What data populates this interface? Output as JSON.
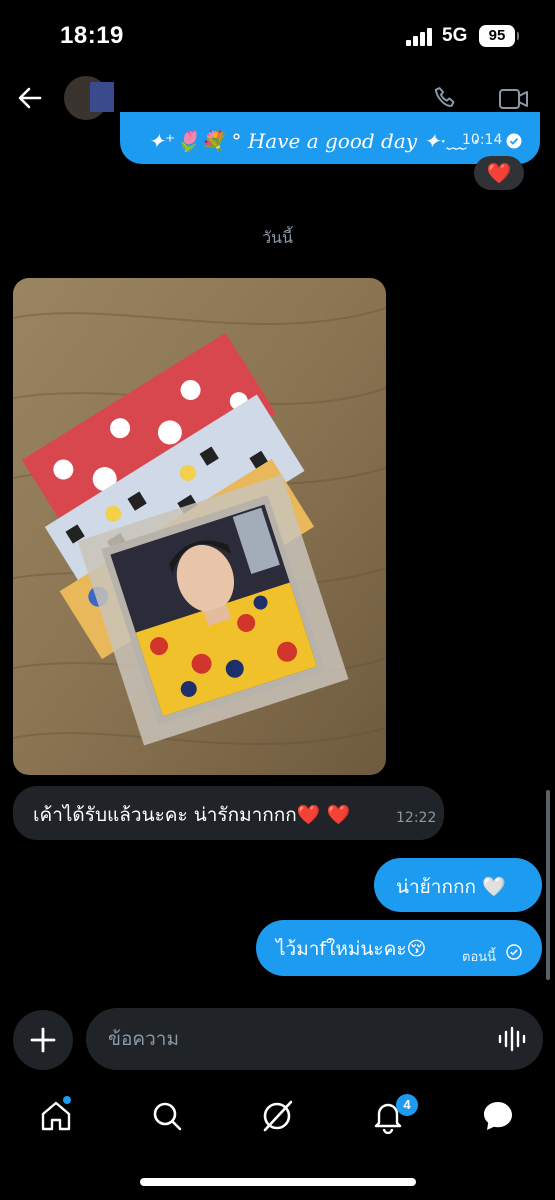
{
  "status_bar": {
    "time": "18:19",
    "network": "5G",
    "battery": "95"
  },
  "header": {
    "back_icon": "arrow-left-icon",
    "call_icon": "phone-icon",
    "video_icon": "video-camera-icon"
  },
  "messages": {
    "prev_message": {
      "text": "✦⁺🌷💐 ° Have a good day ✦·﹏ ·",
      "timestamp": "10:14",
      "reaction": "❤️"
    },
    "date_separator": "วันนี้",
    "incoming": {
      "text": "เค้าได้รับแล้วนะคะ น่ารักมากกก❤️ ❤️",
      "timestamp": "12:22"
    },
    "outgoing_1": {
      "text": "น่าย้ากกก 🤍"
    },
    "outgoing_2": {
      "text": "ไว้มาfใหม่นะคะ😚",
      "timestamp": "ตอนนี้"
    }
  },
  "composer": {
    "placeholder": "ข้อความ"
  },
  "tabbar": {
    "notifications_badge": "4",
    "tabs": [
      "home-icon",
      "search-icon",
      "grok-icon",
      "bell-icon",
      "messages-icon"
    ]
  },
  "colors": {
    "accent": "#1d9bf0",
    "background": "#000000",
    "bubble_incoming": "#202327"
  }
}
